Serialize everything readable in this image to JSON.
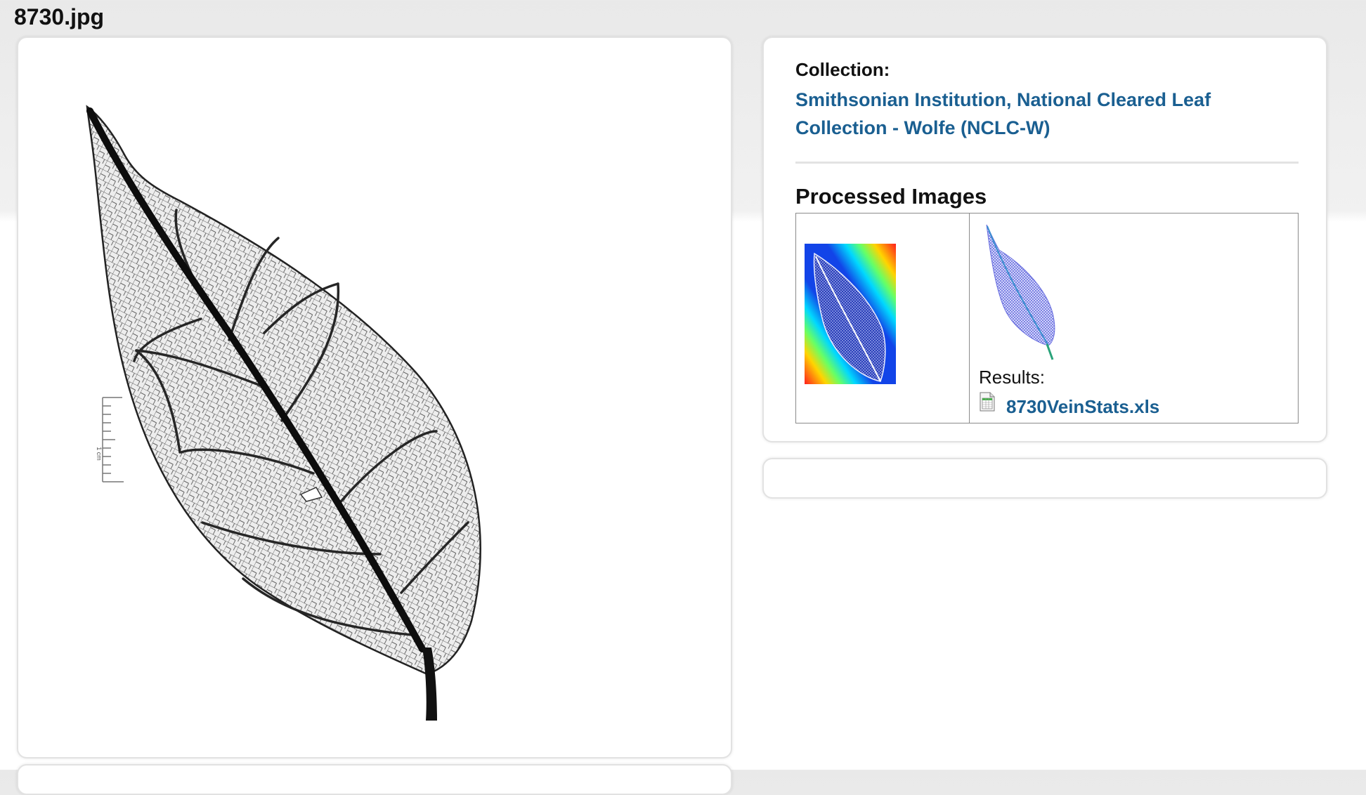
{
  "page": {
    "title": "8730.jpg"
  },
  "leaf_image": {
    "icon": "cleared-leaf-specimen-image",
    "scale_label": "1 cm"
  },
  "collection": {
    "label": "Collection:",
    "name": "Smithsonian Institution, National Cleared Leaf Collection - Wolfe (NCLC-W)",
    "link_color": "#1a5f91"
  },
  "processed_images": {
    "heading": "Processed Images",
    "thumbnails": [
      {
        "icon": "heatmap-leaf-thumbnail"
      },
      {
        "icon": "blue-vein-leaf-thumbnail"
      }
    ],
    "results_label": "Results:",
    "results_file": {
      "icon": "spreadsheet-file-icon",
      "name": "8730VeinStats.xls"
    }
  }
}
